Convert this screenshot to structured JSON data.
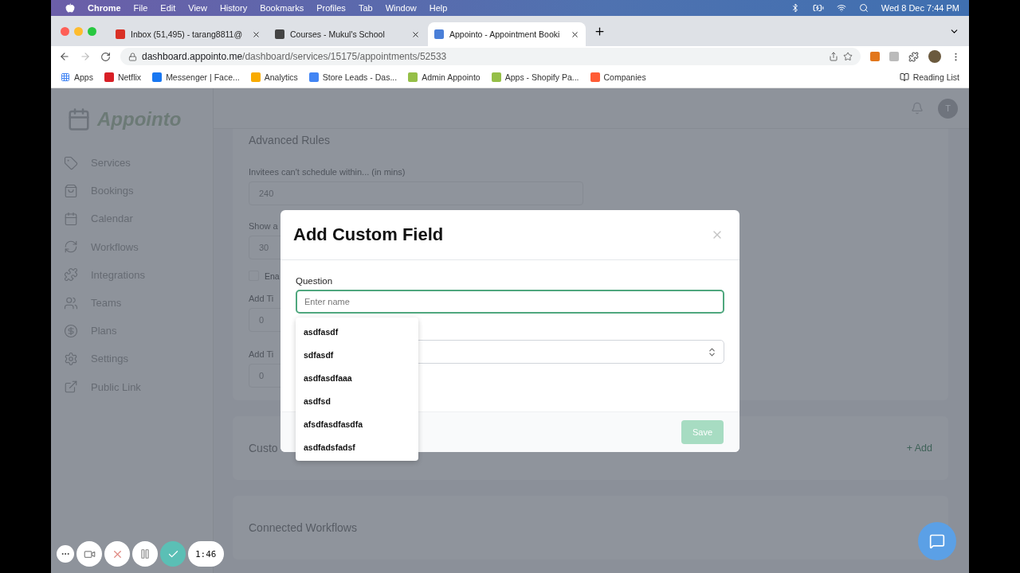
{
  "menubar": {
    "app": "Chrome",
    "menus": [
      "File",
      "Edit",
      "View",
      "History",
      "Bookmarks",
      "Profiles",
      "Tab",
      "Window",
      "Help"
    ],
    "clock": "Wed 8 Dec  7:44 PM"
  },
  "tabs": [
    {
      "title": "Inbox (51,495) - tarang8811@",
      "selected": false
    },
    {
      "title": "Courses - Mukul's School",
      "selected": false
    },
    {
      "title": "Appointo - Appointment Booki",
      "selected": true
    }
  ],
  "address": {
    "host": "dashboard.appointo.me",
    "path": "/dashboard/services/15175/appointments/52533"
  },
  "bookmarks": [
    "Apps",
    "Netflix",
    "Messenger | Face...",
    "Analytics",
    "Store Leads - Das...",
    "Admin Appointo",
    "Apps - Shopify Pa...",
    "Companies"
  ],
  "reading_list": "Reading List",
  "app": {
    "logo": "Appointo",
    "avatar": "T",
    "nav": [
      "Services",
      "Bookings",
      "Calendar",
      "Workflows",
      "Integrations",
      "Teams",
      "Plans",
      "Settings",
      "Public Link"
    ]
  },
  "advanced_rules": {
    "title": "Advanced Rules",
    "fields": [
      {
        "label": "Invitees can't schedule within... (in mins)",
        "value": "240"
      },
      {
        "label": "Show a",
        "value": "30"
      }
    ],
    "checkbox": {
      "label": "Ena",
      "checked": false
    },
    "more_fields": [
      {
        "label": "Add Ti",
        "value": "0"
      },
      {
        "label": "Add Ti",
        "value": "0"
      }
    ]
  },
  "custom_fields_card": {
    "title": "Custo",
    "add": "+ Add"
  },
  "connected_workflows": {
    "title": "Connected Workflows"
  },
  "modal": {
    "title": "Add Custom Field",
    "question_label": "Question",
    "placeholder": "Enter name",
    "suggestions": [
      "asdfasdf",
      "sdfasdf",
      "asdfasdfaaa",
      "asdfsd",
      "afsdfasdfasdfa",
      "asdfadsfadsf"
    ],
    "save": {
      "label": "Save",
      "disabled": true
    }
  },
  "recorder": {
    "timer": "1:46"
  }
}
